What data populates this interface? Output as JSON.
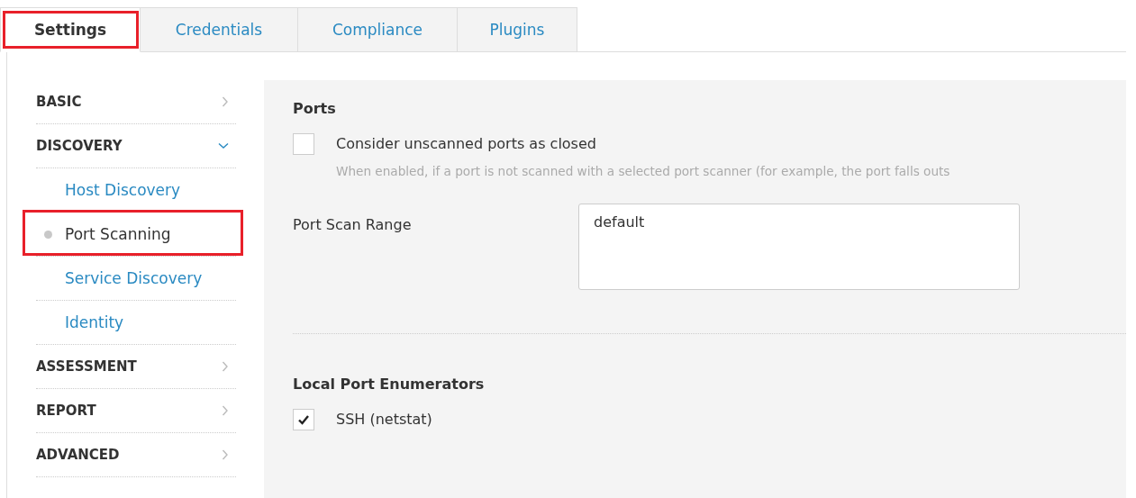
{
  "tabs": [
    {
      "label": "Settings",
      "selected": true,
      "highlighted": true
    },
    {
      "label": "Credentials",
      "selected": false,
      "highlighted": false
    },
    {
      "label": "Compliance",
      "selected": false,
      "highlighted": false
    },
    {
      "label": "Plugins",
      "selected": false,
      "highlighted": false
    }
  ],
  "sidebar": {
    "items": [
      {
        "label": "BASIC",
        "expanded": false
      },
      {
        "label": "DISCOVERY",
        "expanded": true,
        "children": [
          {
            "label": "Host Discovery",
            "selected": false,
            "highlighted": false
          },
          {
            "label": "Port Scanning",
            "selected": true,
            "highlighted": true
          },
          {
            "label": "Service Discovery",
            "selected": false,
            "highlighted": false
          },
          {
            "label": "Identity",
            "selected": false,
            "highlighted": false
          }
        ]
      },
      {
        "label": "ASSESSMENT",
        "expanded": false
      },
      {
        "label": "REPORT",
        "expanded": false
      },
      {
        "label": "ADVANCED",
        "expanded": false
      }
    ]
  },
  "content": {
    "sections": [
      {
        "title": "Ports",
        "items": [
          {
            "kind": "checkbox",
            "label": "Consider unscanned ports as closed",
            "checked": false,
            "description": "When enabled, if a port is not scanned with a selected port scanner (for example, the port falls outs"
          },
          {
            "kind": "textarea",
            "label": "Port Scan Range",
            "value": "default"
          }
        ]
      },
      {
        "title": "Local Port Enumerators",
        "items": [
          {
            "kind": "checkbox",
            "label": "SSH (netstat)",
            "checked": true
          }
        ]
      }
    ]
  }
}
